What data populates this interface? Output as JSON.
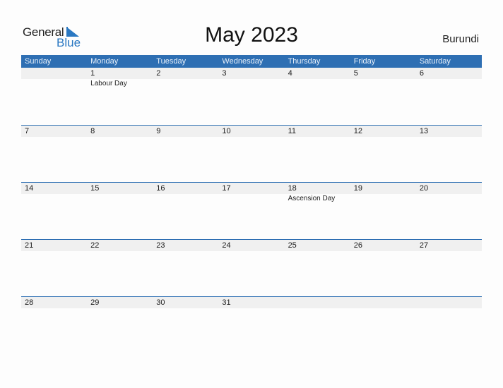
{
  "logo": {
    "line1": "General",
    "line2": "Blue"
  },
  "title": "May 2023",
  "country": "Burundi",
  "colors": {
    "header_bg": "#2e6fb3",
    "accent": "#2a78c2",
    "day_strip": "#f0f0f0"
  },
  "weekdays": [
    "Sunday",
    "Monday",
    "Tuesday",
    "Wednesday",
    "Thursday",
    "Friday",
    "Saturday"
  ],
  "weeks": [
    [
      {
        "day": ""
      },
      {
        "day": "1",
        "holiday": "Labour Day"
      },
      {
        "day": "2"
      },
      {
        "day": "3"
      },
      {
        "day": "4"
      },
      {
        "day": "5"
      },
      {
        "day": "6"
      }
    ],
    [
      {
        "day": "7"
      },
      {
        "day": "8"
      },
      {
        "day": "9"
      },
      {
        "day": "10"
      },
      {
        "day": "11"
      },
      {
        "day": "12"
      },
      {
        "day": "13"
      }
    ],
    [
      {
        "day": "14"
      },
      {
        "day": "15"
      },
      {
        "day": "16"
      },
      {
        "day": "17"
      },
      {
        "day": "18",
        "holiday": "Ascension Day"
      },
      {
        "day": "19"
      },
      {
        "day": "20"
      }
    ],
    [
      {
        "day": "21"
      },
      {
        "day": "22"
      },
      {
        "day": "23"
      },
      {
        "day": "24"
      },
      {
        "day": "25"
      },
      {
        "day": "26"
      },
      {
        "day": "27"
      }
    ],
    [
      {
        "day": "28"
      },
      {
        "day": "29"
      },
      {
        "day": "30"
      },
      {
        "day": "31"
      },
      {
        "day": ""
      },
      {
        "day": ""
      },
      {
        "day": ""
      }
    ]
  ]
}
